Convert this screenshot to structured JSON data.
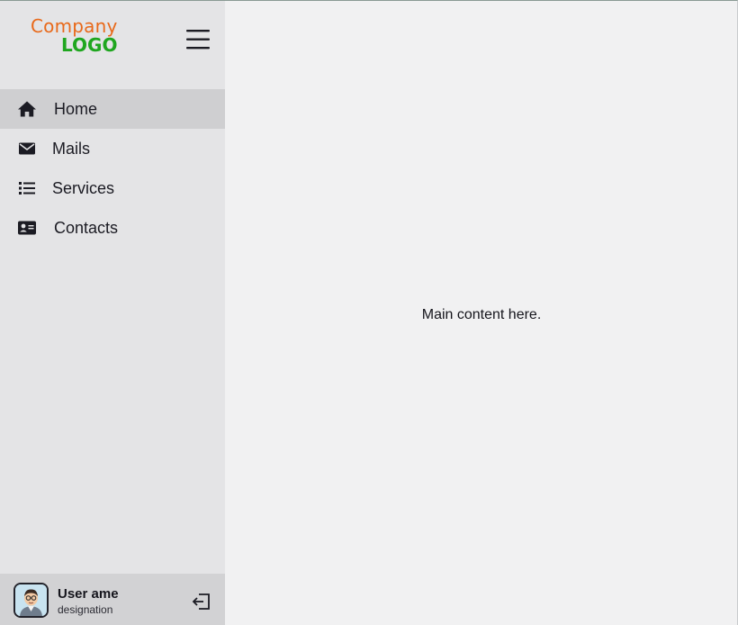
{
  "brand": {
    "line1": "Company",
    "line2": "LOGO",
    "line1_color": "#e8691a",
    "line2_color": "#1fa61f"
  },
  "header": {
    "menu_icon": "hamburger-menu-icon"
  },
  "sidebar": {
    "items": [
      {
        "label": "Home",
        "icon": "home-icon",
        "active": true
      },
      {
        "label": "Mails",
        "icon": "envelope-icon",
        "active": false
      },
      {
        "label": "Services",
        "icon": "list-icon",
        "active": false
      },
      {
        "label": "Contacts",
        "icon": "contact-card-icon",
        "active": false
      }
    ]
  },
  "user": {
    "name": "User ame",
    "designation": "designation",
    "avatar_icon": "user-avatar",
    "logout_icon": "logout-icon"
  },
  "main": {
    "content": "Main content here."
  },
  "colors": {
    "sidebar_bg": "#e4e4e6",
    "active_item_bg": "#cfcfd1",
    "main_bg": "#f1f1f2",
    "user_panel_bg": "#d2d2d4",
    "icon_color": "#1b1b23"
  }
}
